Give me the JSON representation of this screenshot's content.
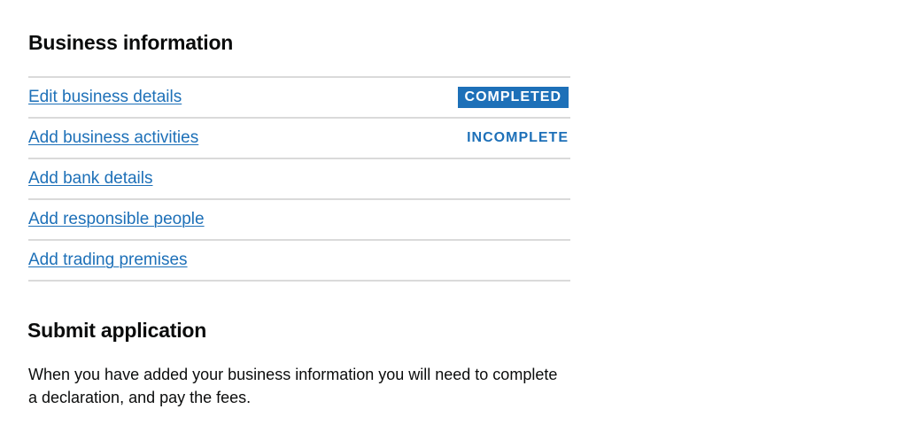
{
  "business_section": {
    "heading": "Business information",
    "tasks": [
      {
        "label": "Edit business details",
        "status": "COMPLETED"
      },
      {
        "label": "Add business activities",
        "status": "INCOMPLETE"
      },
      {
        "label": "Add bank details",
        "status": ""
      },
      {
        "label": "Add responsible people",
        "status": ""
      },
      {
        "label": "Add trading premises",
        "status": ""
      }
    ]
  },
  "submit_section": {
    "heading": "Submit application",
    "body": "When you have added your business information you will need to complete a declaration, and pay the fees."
  },
  "colors": {
    "link": "#1d70b8",
    "text": "#0b0c0c",
    "border": "#dadada",
    "tag_completed_bg": "#1d70b8",
    "tag_completed_text": "#ffffff"
  }
}
